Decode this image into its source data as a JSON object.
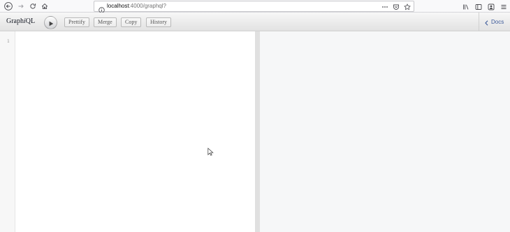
{
  "browser": {
    "url_host": "localhost",
    "url_path": ":4000/graphql?",
    "icons": [
      "back-icon",
      "forward-icon",
      "reload-icon",
      "home-icon",
      "info-icon",
      "page-actions-icon",
      "pocket-icon",
      "bookmark-star-icon",
      "library-icon",
      "sidebar-icon",
      "account-icon",
      "menu-icon"
    ]
  },
  "toolbar": {
    "title_prefix": "Graph",
    "title_italic": "i",
    "title_suffix": "QL",
    "prettify": "Prettify",
    "merge": "Merge",
    "copy": "Copy",
    "history": "History",
    "docs": "Docs"
  },
  "editor": {
    "line_numbers": [
      "1"
    ]
  },
  "colors": {
    "docs_link": "#3b5998",
    "result_background": "#f6f7f8",
    "toolbar_gradient_top": "#f7f7f7",
    "toolbar_gradient_bottom": "#e2e2e2"
  }
}
